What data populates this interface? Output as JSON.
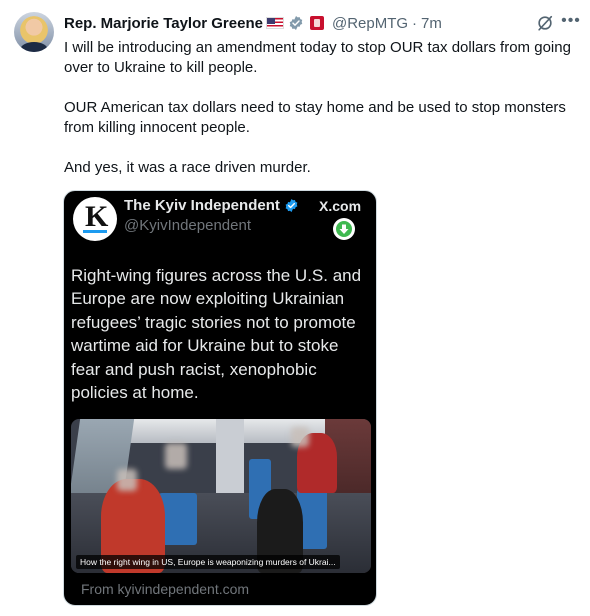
{
  "tweet": {
    "author_name": "Rep. Marjorie Taylor Greene",
    "handle": "@RepMTG",
    "separator": "·",
    "time": "7m",
    "paragraphs": [
      "I will be introducing an amendment today to stop OUR tax dollars from going over to Ukraine to kill people.",
      "OUR American tax dollars need to stay home and be used to stop monsters from killing innocent people.",
      "And yes, it was a race driven murder."
    ]
  },
  "card": {
    "source_name": "The Kyiv Independent",
    "source_handle": "@KyivIndependent",
    "platform": "X.com",
    "logo_letter": "K",
    "quote_text": "Right-wing figures across the U.S. and Europe are now exploiting Ukrainian refugees’ tragic stories not to promote wartime aid for Ukraine but to stoke fear and push racist, xenophobic policies at home.",
    "media_caption": "How the right wing in US, Europe is weaponizing murders of Ukrai...",
    "from_text": "From kyivindependent.com"
  },
  "colors": {
    "text_primary": "#0f1419",
    "text_secondary": "#536471",
    "card_bg": "#000000",
    "verified_blue": "#1d9bf0",
    "verified_grey": "#829aab",
    "download_green": "#3fb950"
  },
  "icons": [
    "avatar",
    "us-flag-icon",
    "grey-verified-icon",
    "government-badge-icon",
    "grok-icon",
    "more-icon",
    "blue-verified-icon",
    "download-icon"
  ]
}
